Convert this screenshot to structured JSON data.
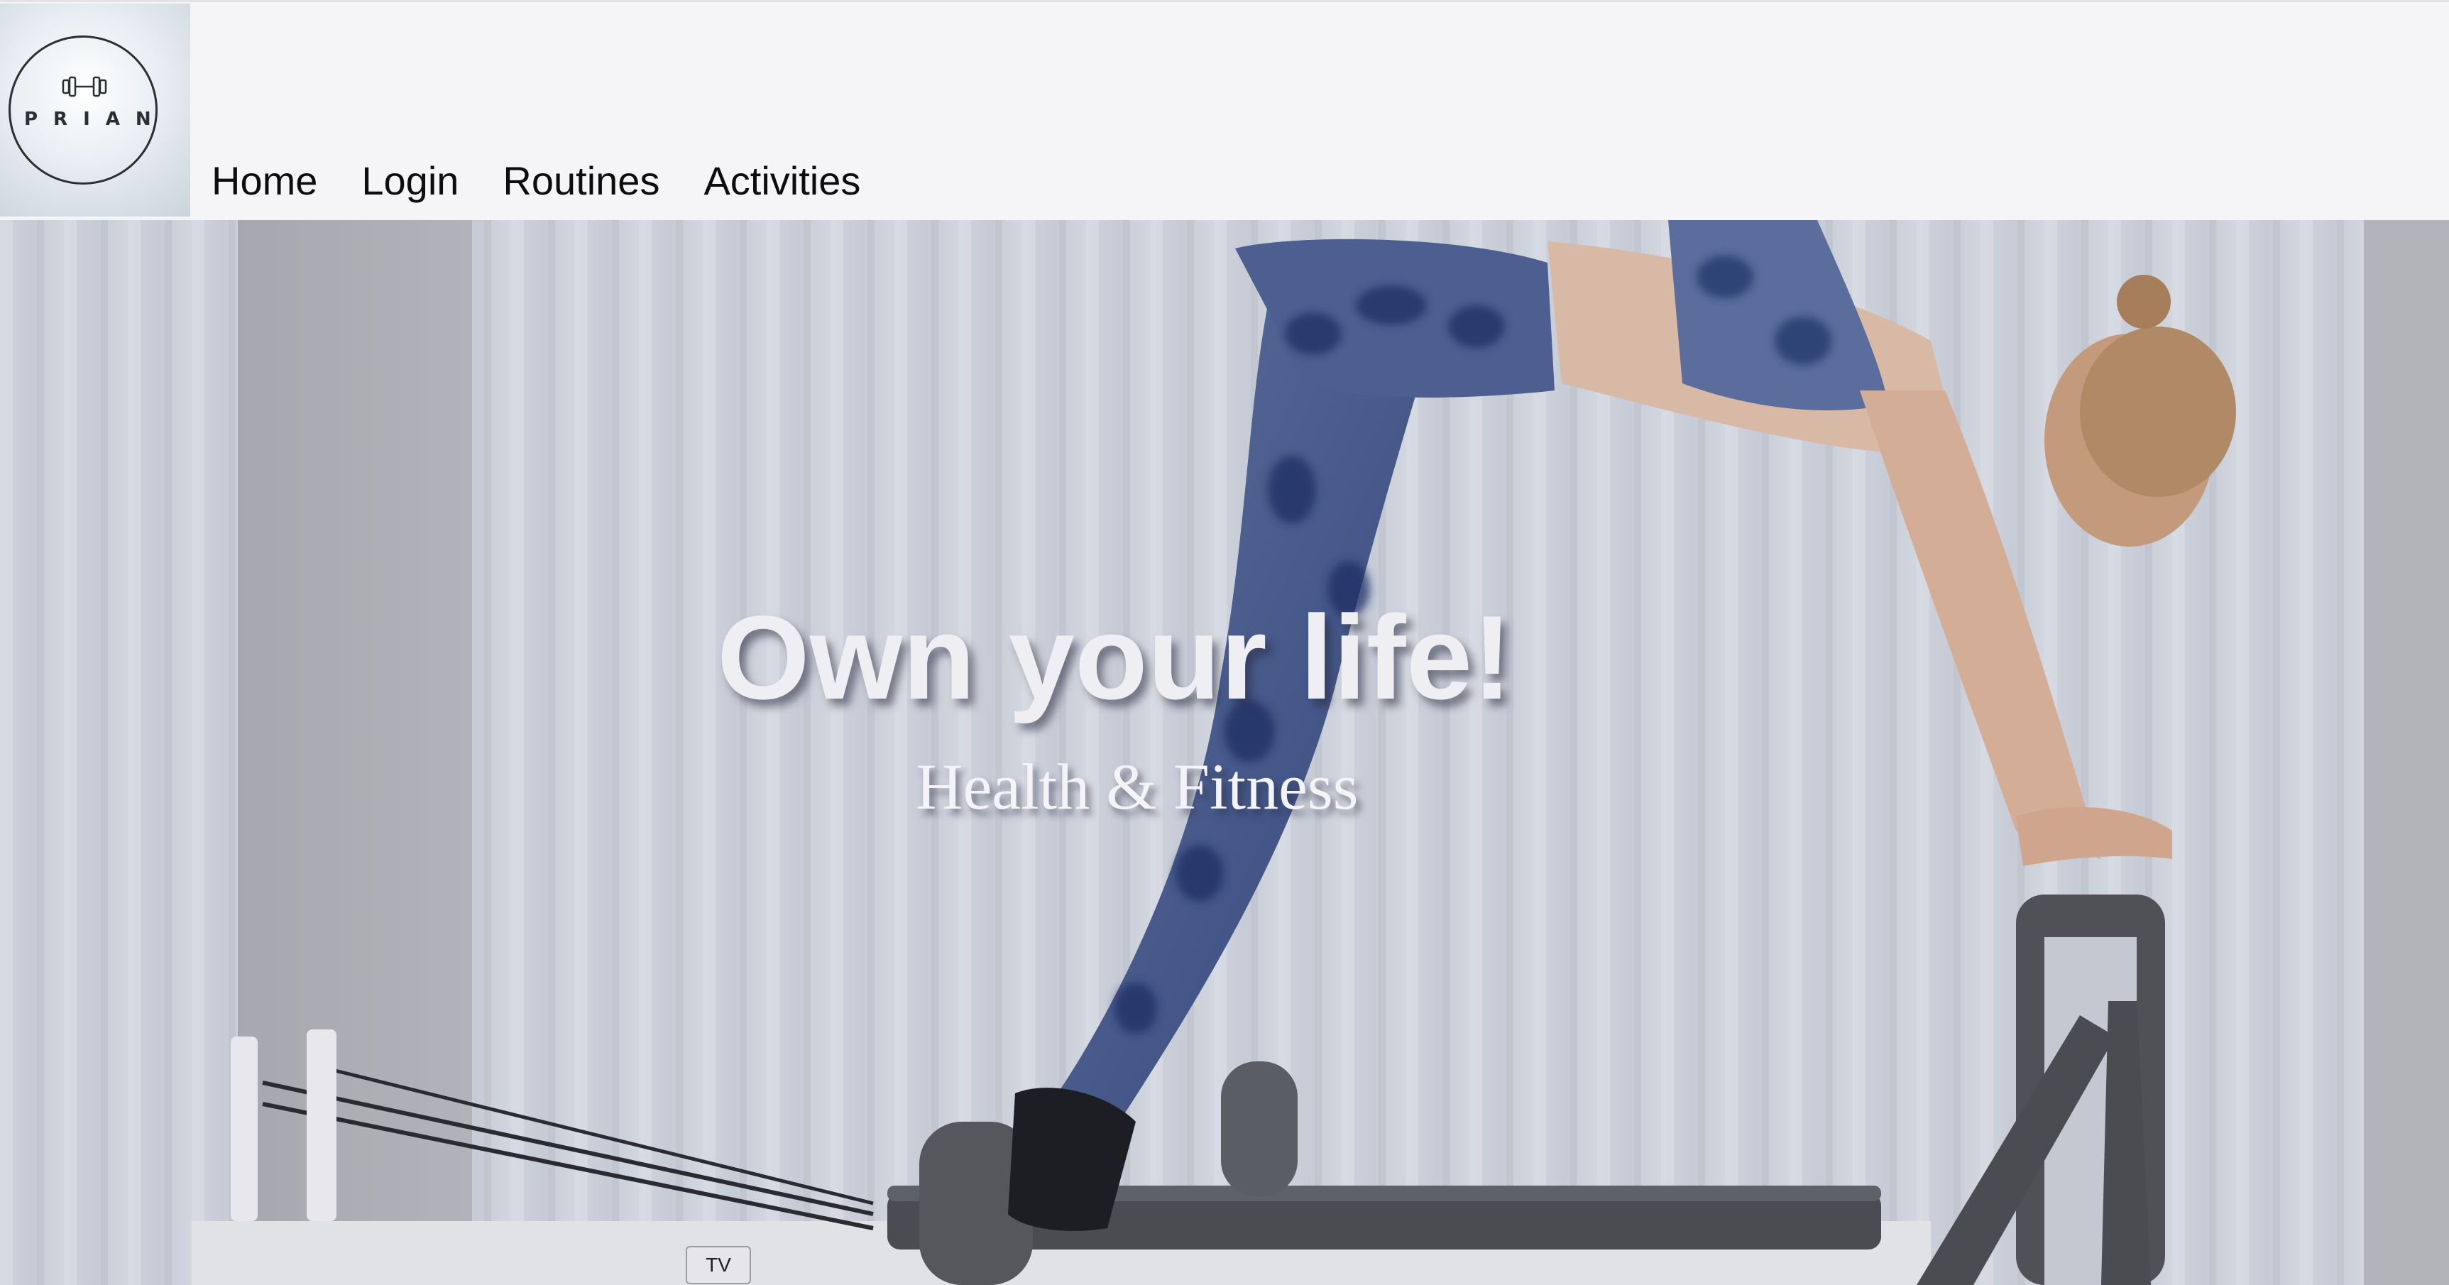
{
  "logo": {
    "text": "PRIAN",
    "icon": "dumbbell-icon"
  },
  "nav": {
    "items": [
      {
        "label": "Home"
      },
      {
        "label": "Login"
      },
      {
        "label": "Routines"
      },
      {
        "label": "Activities"
      }
    ]
  },
  "hero": {
    "title": "Own your life!",
    "subtitle": "Health & Fitness",
    "badge": "TV"
  },
  "colors": {
    "header_bg": "#f5f5f7",
    "nav_text": "#0d0d0d",
    "hero_text": "#eeeef3"
  }
}
